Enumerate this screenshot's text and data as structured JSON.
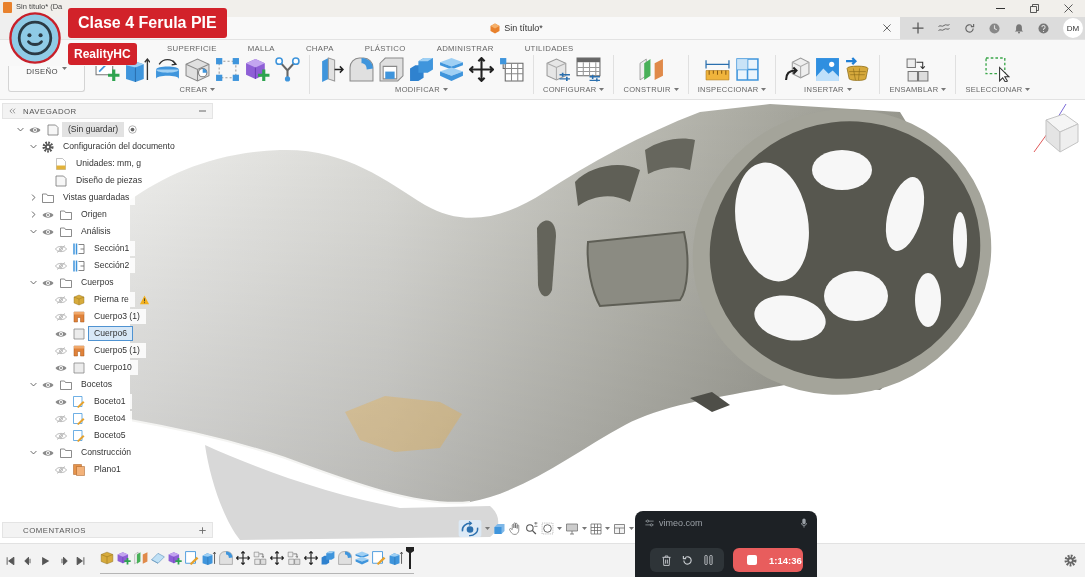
{
  "window": {
    "title": "Sin título* (Da"
  },
  "video_overlay": {
    "title": "Clase 4 Ferula PIE",
    "channel": "RealityHC"
  },
  "document_tab": {
    "title": "Sin título*"
  },
  "account": {
    "initials": "DM"
  },
  "toolbar": {
    "workspace": "DISEÑO",
    "tabs": [
      "SUPERFICIE",
      "MALLA",
      "CHAPA",
      "PLÁSTICO",
      "ADMINISTRAR",
      "UTILIDADES"
    ],
    "groups": [
      {
        "label": "CREAR"
      },
      {
        "label": "MODIFICAR"
      },
      {
        "label": "CONFIGURAR"
      },
      {
        "label": "CONSTRUIR"
      },
      {
        "label": "INSPECCIONAR"
      },
      {
        "label": "INSERTAR"
      },
      {
        "label": "ENSAMBLAR"
      },
      {
        "label": "SELECCIONAR"
      }
    ]
  },
  "navigator": {
    "title": "NAVEGADOR",
    "tree": [
      {
        "label": "(Sin guardar)",
        "kind": "component",
        "expanded": true,
        "visible": true,
        "active": true,
        "selected": false,
        "children": [
          {
            "label": "Configuración del documento",
            "kind": "settings",
            "expanded": true,
            "selected": false,
            "children": [
              {
                "label": "Unidades: mm, g",
                "kind": "units",
                "selected": false
              },
              {
                "label": "Diseño de piezas",
                "kind": "design",
                "selected": false
              }
            ]
          },
          {
            "label": "Vistas guardadas",
            "kind": "folder",
            "expanded": false,
            "selected": false
          },
          {
            "label": "Origen",
            "kind": "folder",
            "expanded": false,
            "visible": true,
            "selected": false
          },
          {
            "label": "Análisis",
            "kind": "folder",
            "expanded": true,
            "visible": true,
            "selected": false,
            "children": [
              {
                "label": "Sección1",
                "kind": "section",
                "visible": false,
                "selected": false
              },
              {
                "label": "Sección2",
                "kind": "section",
                "visible": false,
                "selected": false
              }
            ]
          },
          {
            "label": "Cuerpos",
            "kind": "folder",
            "expanded": true,
            "visible": true,
            "selected": false,
            "children": [
              {
                "label": "Pierna re",
                "kind": "mesh",
                "visible": false,
                "warning": true,
                "selected": false
              },
              {
                "label": "Cuerpo3 (1)",
                "kind": "form",
                "visible": false,
                "selected": false
              },
              {
                "label": "Cuerpo6",
                "kind": "solid",
                "visible": true,
                "selected": true
              },
              {
                "label": "Cuerpo5 (1)",
                "kind": "form",
                "visible": false,
                "selected": false
              },
              {
                "label": "Cuerpo10",
                "kind": "solid",
                "visible": true,
                "selected": false
              }
            ]
          },
          {
            "label": "Bocetos",
            "kind": "folder",
            "expanded": true,
            "visible": true,
            "selected": false,
            "children": [
              {
                "label": "Boceto1",
                "kind": "sketch",
                "visible": true,
                "selected": false
              },
              {
                "label": "Boceto4",
                "kind": "sketch",
                "visible": false,
                "selected": false
              },
              {
                "label": "Boceto5",
                "kind": "sketch",
                "visible": false,
                "selected": false
              }
            ]
          },
          {
            "label": "Construcción",
            "kind": "folder",
            "expanded": true,
            "visible": true,
            "selected": false,
            "children": [
              {
                "label": "Plano1",
                "kind": "plane",
                "visible": false,
                "selected": false
              }
            ]
          }
        ]
      }
    ]
  },
  "comments": {
    "title": "COMENTARIOS"
  },
  "recorder": {
    "site": "vimeo.com",
    "time": "1:14:36"
  }
}
